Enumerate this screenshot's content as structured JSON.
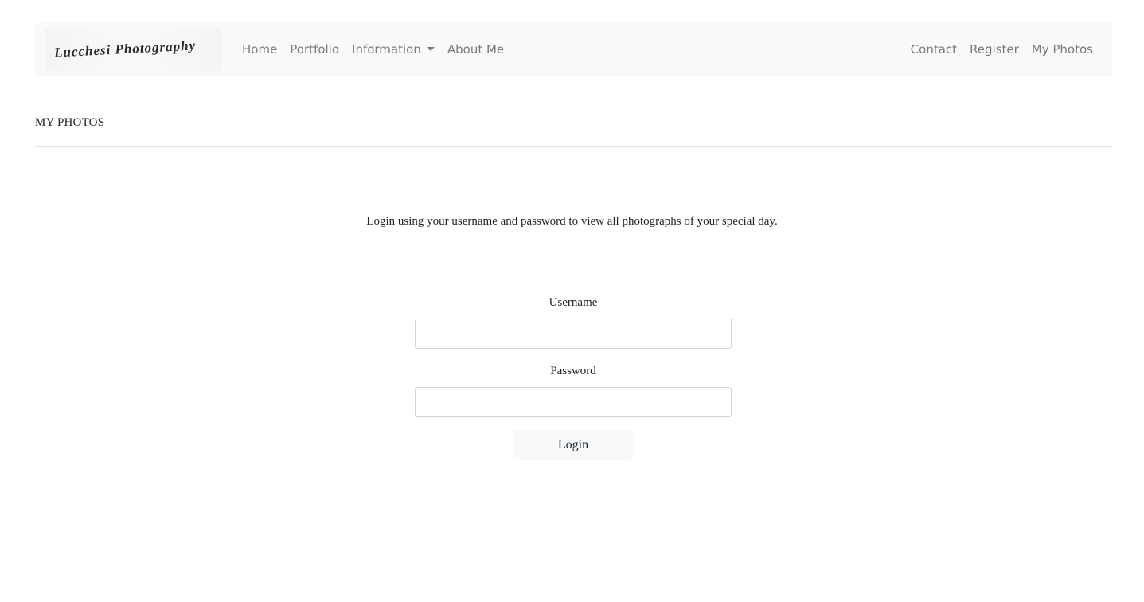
{
  "navbar": {
    "brand_text": "Lucchesi Photography",
    "left_links": [
      {
        "label": "Home"
      },
      {
        "label": "Portfolio"
      },
      {
        "label": "Information",
        "has_dropdown": true
      },
      {
        "label": "About Me"
      }
    ],
    "right_links": [
      {
        "label": "Contact"
      },
      {
        "label": "Register"
      },
      {
        "label": "My Photos"
      }
    ]
  },
  "page": {
    "title": "MY PHOTOS",
    "intro": "Login using your username and password to view all photographs of your special day."
  },
  "login_form": {
    "username_label": "Username",
    "username_value": "",
    "password_label": "Password",
    "password_value": "",
    "submit_label": "Login"
  },
  "colors": {
    "navbar_bg": "#f8f9fa",
    "nav_link": "#7a7a7a",
    "text": "#212529",
    "input_border": "#ced4da",
    "divider": "#e3e3e3"
  },
  "icons": {
    "dropdown": "caret-down-icon"
  }
}
